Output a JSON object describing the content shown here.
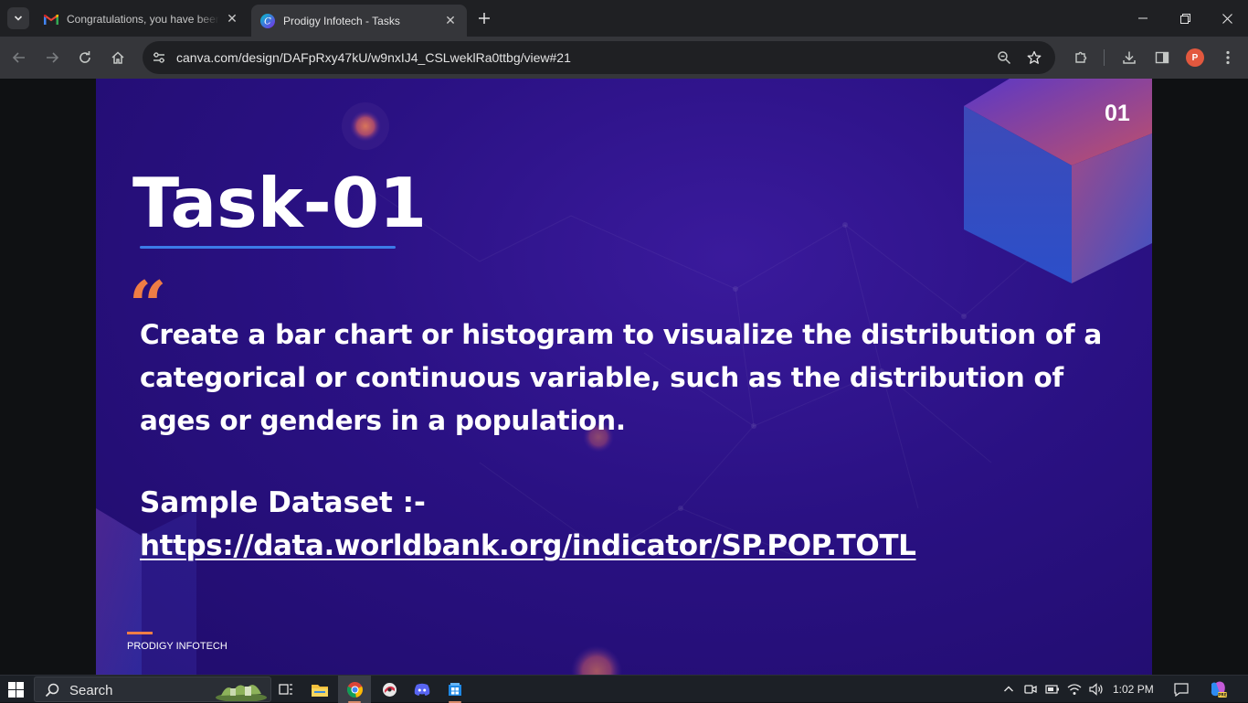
{
  "browser": {
    "tabs": [
      {
        "title": "Congratulations, you have been",
        "favicon": "gmail-icon",
        "active": false
      },
      {
        "title": "Prodigy Infotech - Tasks",
        "favicon": "canva-icon",
        "active": true
      }
    ],
    "url": "canva.com/design/DAFpRxy47kU/w9nxIJ4_CSLweklRa0ttbg/view#21",
    "profile_initial": "P"
  },
  "slide": {
    "number": "01",
    "title": "Task-01",
    "quote_mark": "“",
    "task_text": "Create a bar chart or histogram to visualize the distribution of a categorical or continuous variable, such as the distribution of ages or genders in a population.",
    "dataset_label": "Sample Dataset :-",
    "dataset_link": "https://data.worldbank.org/indicator/SP.POP.TOTL",
    "footer_brand": "PRODIGY INFOTECH",
    "colors": {
      "accent_orange": "#ef7d45",
      "underline_blue": "#3c7be8",
      "background": "#2a1183"
    }
  },
  "taskbar": {
    "search_label": "Search",
    "time": "1:02 PM"
  }
}
